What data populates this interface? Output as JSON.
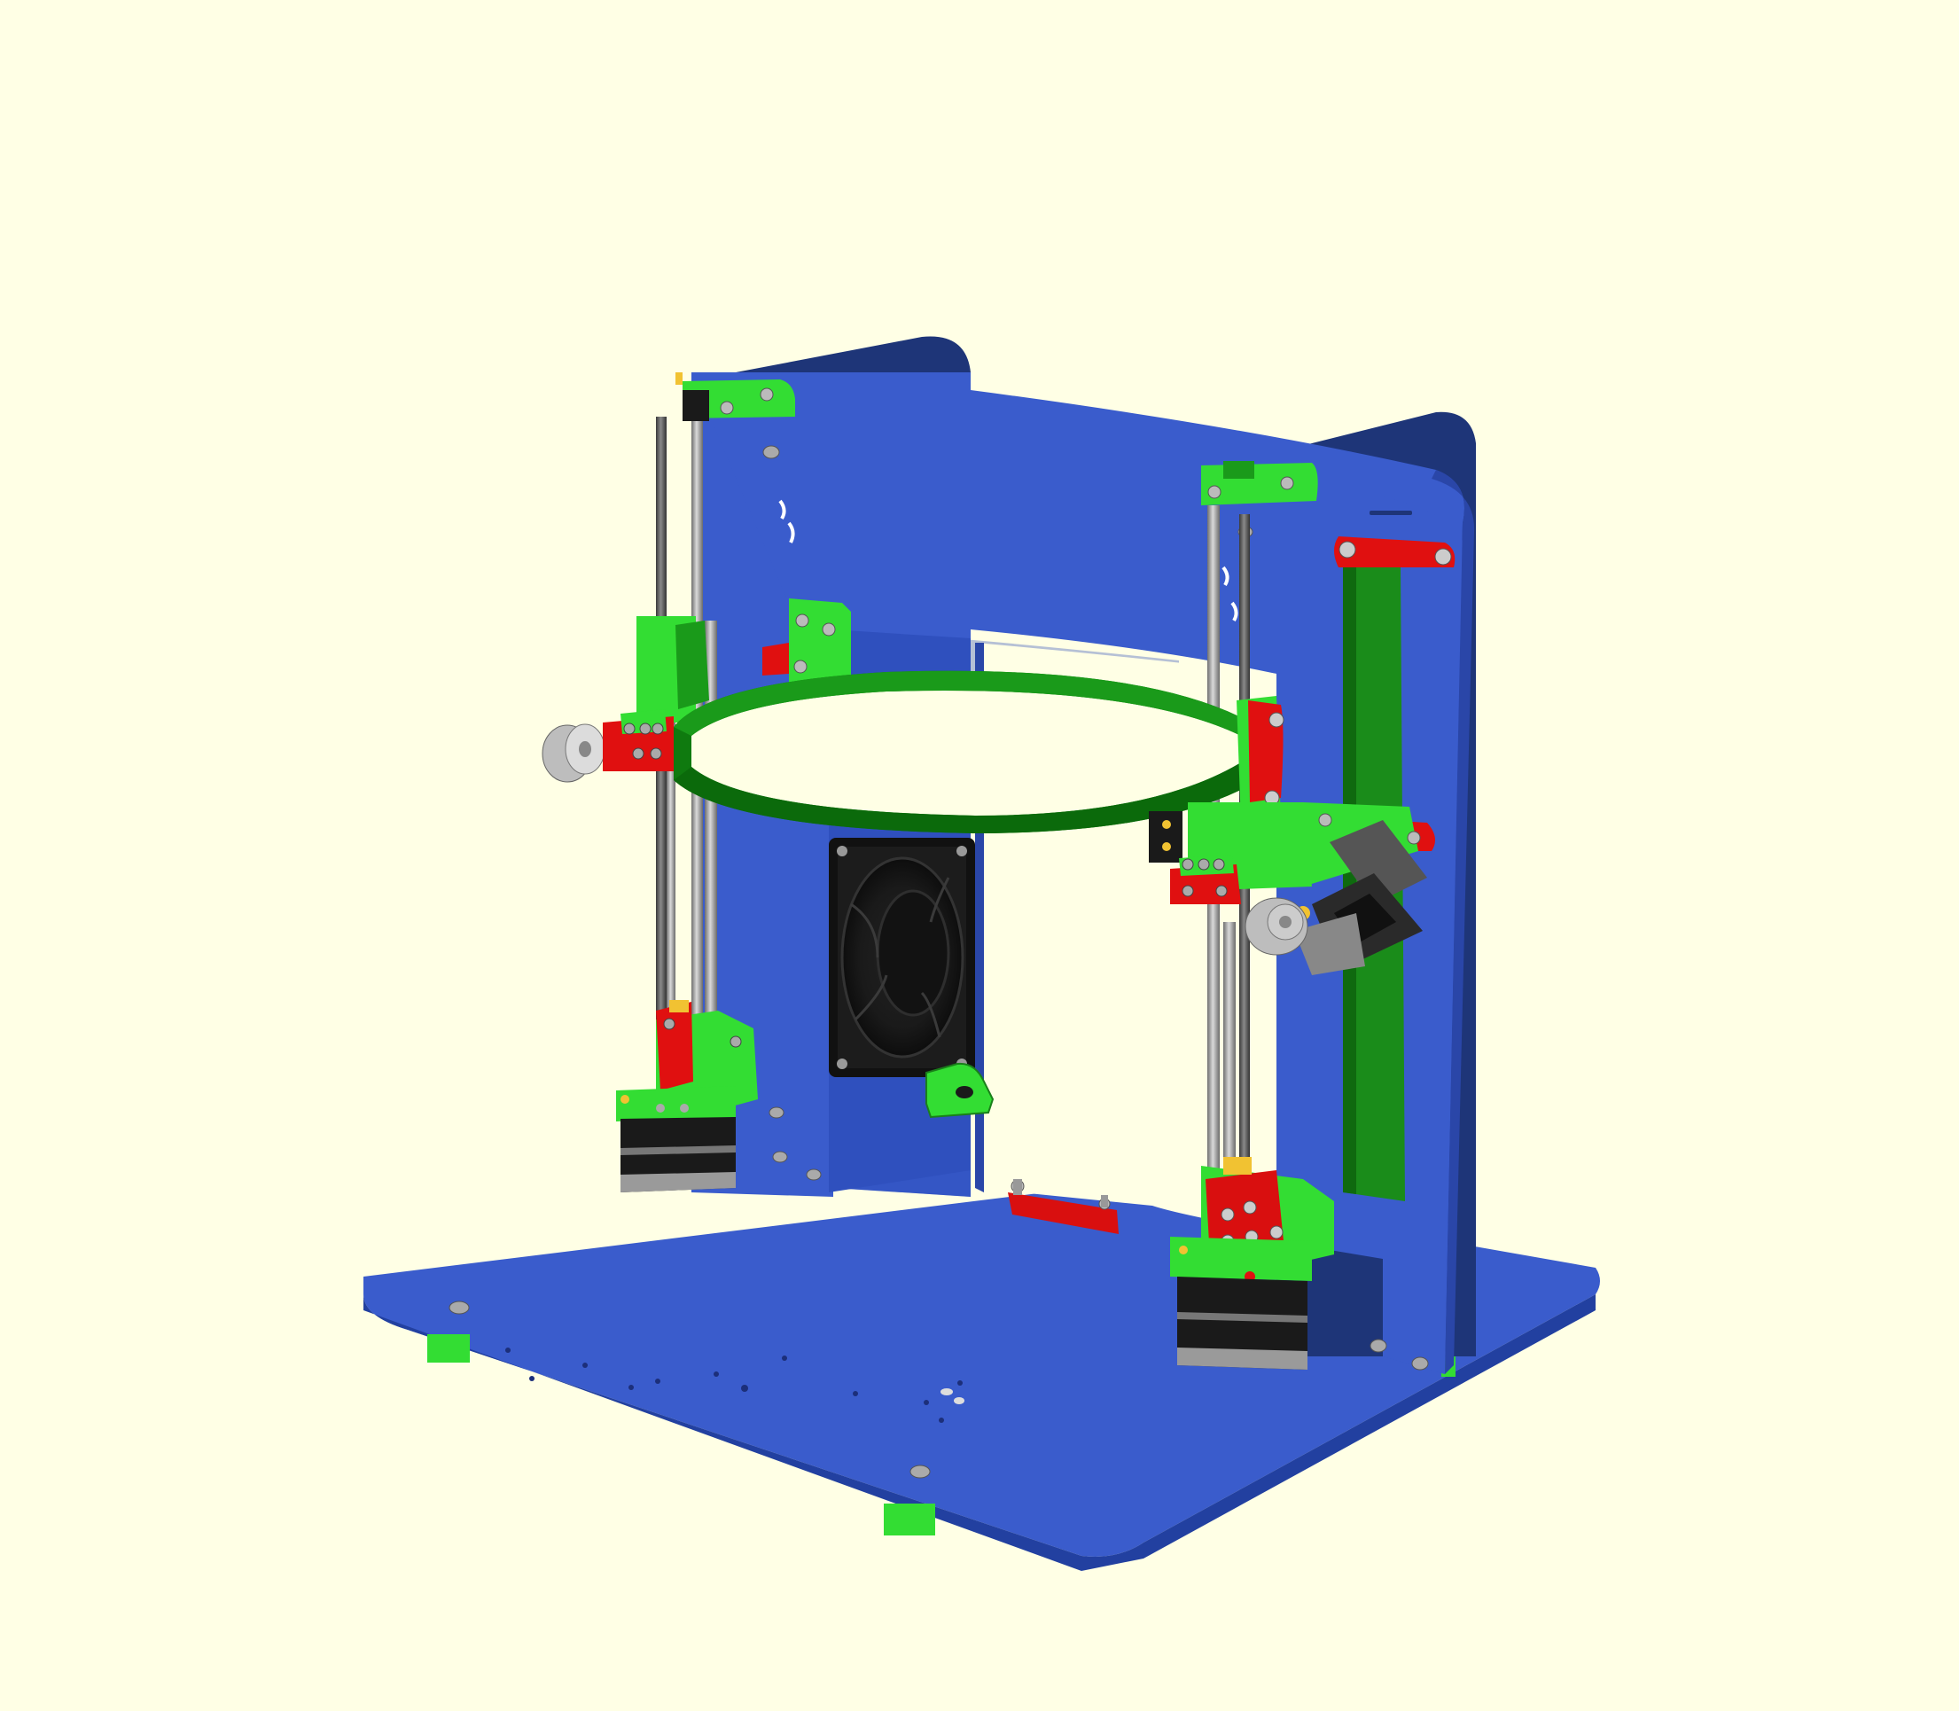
{
  "viewport": {
    "background": "#ffffe5"
  },
  "model": {
    "description_colors": {
      "panel_blue": "#3a5ccc",
      "panel_blue_dark": "#2a46a8",
      "panel_blue_edge": "#1e3a8a",
      "printed_green": "#33dd33",
      "printed_green_dark": "#1a7f1a",
      "belt_green": "#0f7a0f",
      "part_red": "#e01010",
      "metal_gray": "#9a9a9a",
      "motor_black": "#1a1a1a"
    },
    "icons": {
      "fan": "fan-icon",
      "stepper_motor": "stepper-motor-icon",
      "pulley": "pulley-icon",
      "rod": "rod-icon"
    }
  }
}
